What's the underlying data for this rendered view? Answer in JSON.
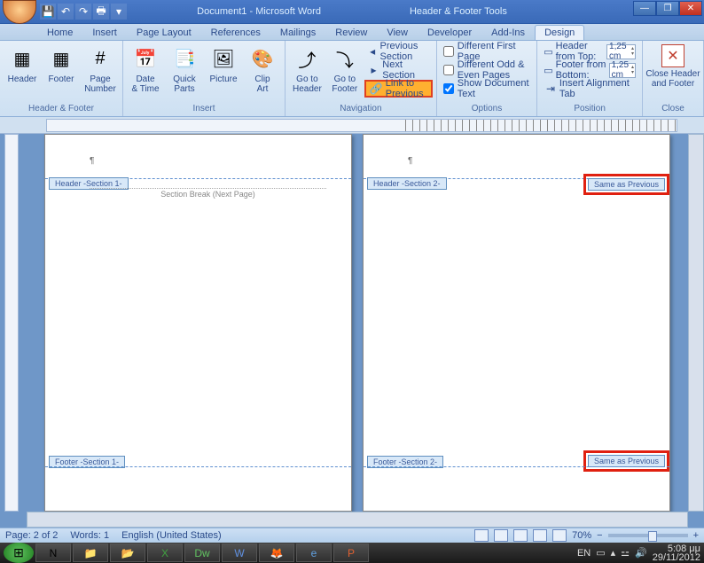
{
  "title": {
    "doc": "Document1 - Microsoft Word",
    "context": "Header & Footer Tools"
  },
  "tabs": [
    "Home",
    "Insert",
    "Page Layout",
    "References",
    "Mailings",
    "Review",
    "View",
    "Developer",
    "Add-Ins",
    "Design"
  ],
  "groups": {
    "hf": {
      "label": "Header & Footer",
      "header": "Header",
      "footer": "Footer",
      "page_no": "Page\nNumber"
    },
    "insert": {
      "label": "Insert",
      "date": "Date\n& Time",
      "quick": "Quick\nParts",
      "pic": "Picture",
      "clip": "Clip\nArt"
    },
    "nav": {
      "label": "Navigation",
      "gotoH": "Go to\nHeader",
      "gotoF": "Go to\nFooter",
      "prev": "Previous Section",
      "next": "Next Section",
      "link": "Link to Previous"
    },
    "opt": {
      "label": "Options",
      "diff_first": "Different First Page",
      "diff_oe": "Different Odd & Even Pages",
      "show_doc": "Show Document Text"
    },
    "pos": {
      "label": "Position",
      "hdr_top": "Header from Top:",
      "ftr_bot": "Footer from Bottom:",
      "align": "Insert Alignment Tab",
      "val": "1,25 cm"
    },
    "close": {
      "label": "Close",
      "btn": "Close Header\nand Footer"
    }
  },
  "page_tags": {
    "hdr1": "Header -Section 1-",
    "hdr2": "Header -Section 2-",
    "ftr1": "Footer -Section 1-",
    "ftr2": "Footer -Section 2-",
    "same": "Same as Previous",
    "break": "Section Break (Next Page)"
  },
  "status": {
    "page": "Page: 2 of 2",
    "words": "Words: 1",
    "lang": "English (United States)",
    "zoom": "70%"
  },
  "tray": {
    "lang": "EN",
    "time": "5:08 μμ",
    "date": "29/11/2012"
  }
}
